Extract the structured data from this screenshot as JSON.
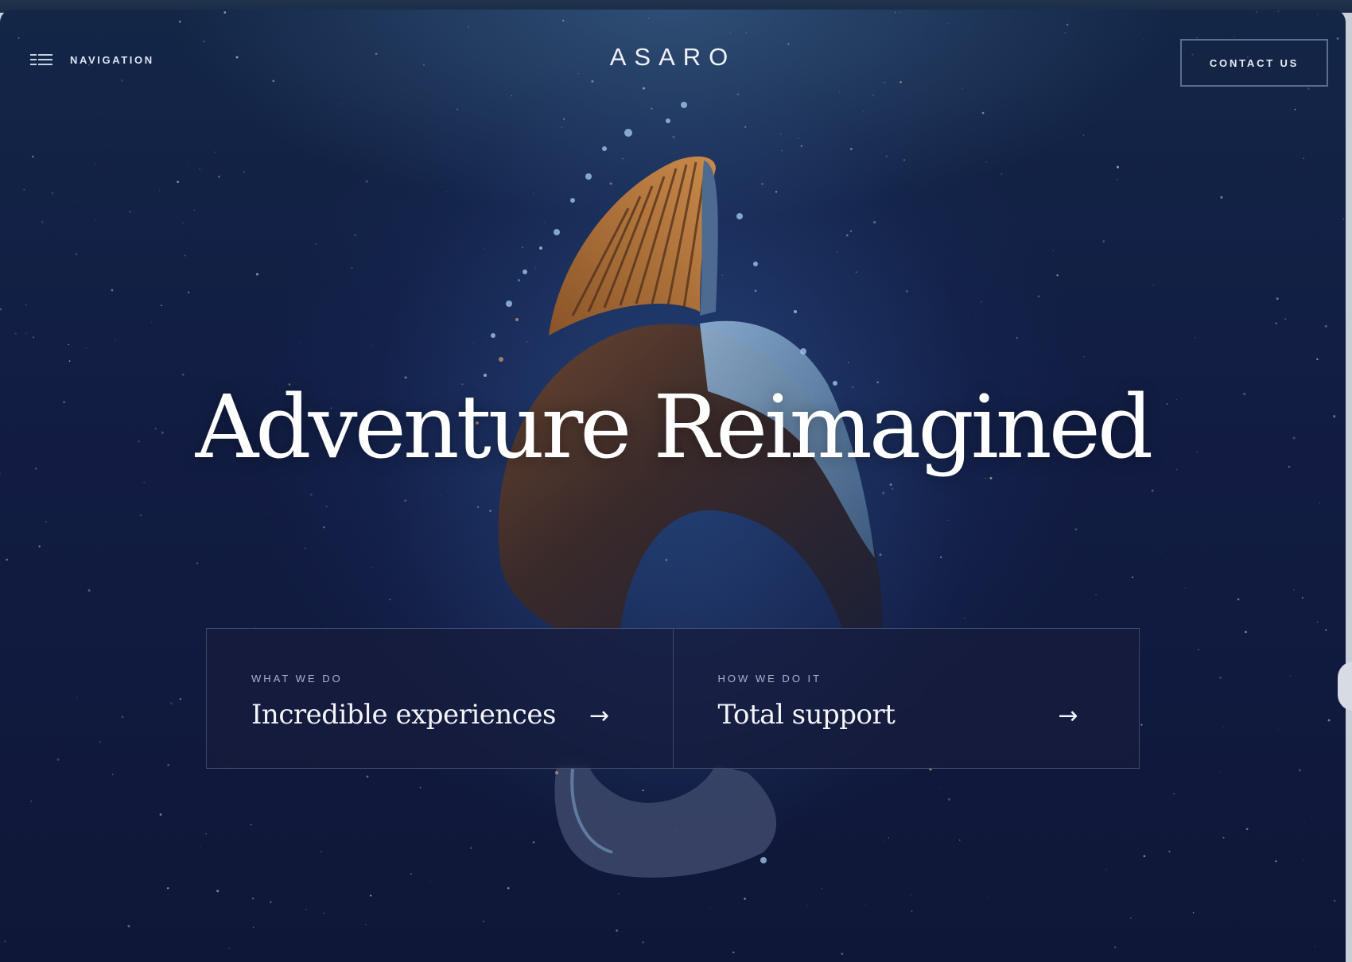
{
  "header": {
    "nav_label": "NAVIGATION",
    "brand": "ASARO",
    "contact_label": "CONTACT US"
  },
  "hero": {
    "headline": "Adventure Reimagined"
  },
  "cards": [
    {
      "kicker": "WHAT WE DO",
      "title": "Incredible experiences",
      "arrow": "→"
    },
    {
      "kicker": "HOW WE DO IT",
      "title": "Total support",
      "arrow": "→"
    }
  ],
  "icons": {
    "menu": "menu-icon",
    "arrow": "arrow-right-icon"
  },
  "colors": {
    "background": "#121d44",
    "text": "#ffffff",
    "accent_orange": "#b86a2a",
    "accent_blue": "#6f93b8"
  }
}
